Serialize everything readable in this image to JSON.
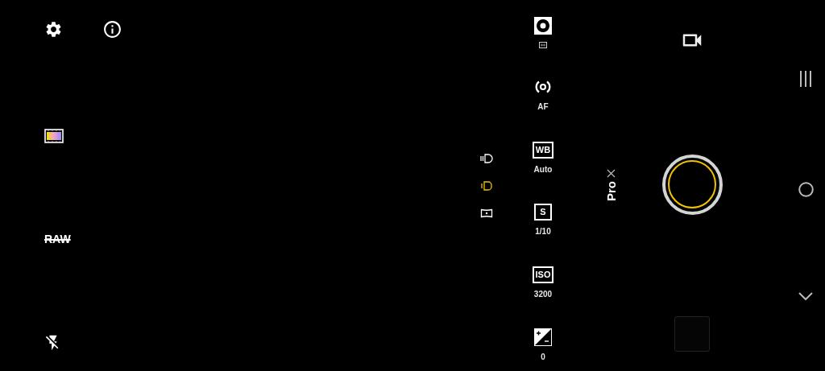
{
  "raw": {
    "label": "RAW",
    "on": false
  },
  "flash": {
    "on": false
  },
  "metering_modes": [
    {
      "kind": "matrix",
      "selected": false
    },
    {
      "kind": "center",
      "selected": true
    },
    {
      "kind": "spot",
      "selected": false
    }
  ],
  "pro_settings": [
    {
      "kind": "metering"
    },
    {
      "kind": "focus",
      "value": "AF"
    },
    {
      "kind": "badge",
      "badge": "WB",
      "value": "Auto"
    },
    {
      "kind": "badge",
      "badge": "S",
      "value": "1/10"
    },
    {
      "kind": "badge",
      "badge": "ISO",
      "value": "3200"
    },
    {
      "kind": "exposure",
      "value": "0"
    }
  ],
  "mode": {
    "label": "Pro"
  }
}
